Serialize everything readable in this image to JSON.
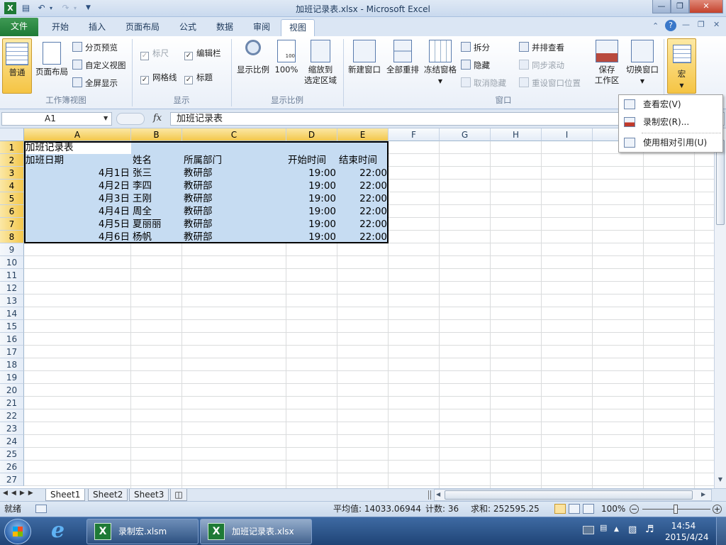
{
  "window": {
    "title": "加班记录表.xlsx - Microsoft Excel"
  },
  "ribbon_tabs": {
    "file": "文件",
    "home": "开始",
    "insert": "插入",
    "layout": "页面布局",
    "formula": "公式",
    "data": "数据",
    "review": "审阅",
    "view": "视图"
  },
  "ribbon": {
    "workbook_views": {
      "normal": "普通",
      "page_layout": "页面布局",
      "page_break": "分页预览",
      "custom_view": "自定义视图",
      "full_screen": "全屏显示",
      "group": "工作簿视图"
    },
    "show": {
      "ruler": "标尺",
      "formula_bar": "编辑栏",
      "gridlines": "网格线",
      "headings": "标题",
      "group": "显示"
    },
    "zoom": {
      "zoom": "显示比例",
      "hundred": "100%",
      "zoom_sel_1": "缩放到",
      "zoom_sel_2": "选定区域",
      "group": "显示比例"
    },
    "window": {
      "new_window": "新建窗口",
      "arrange_all": "全部重排",
      "freeze": "冻结窗格",
      "split": "拆分",
      "hide": "隐藏",
      "unhide": "取消隐藏",
      "side_by_side": "并排查看",
      "sync_scroll": "同步滚动",
      "reset_pos": "重设窗口位置",
      "save_ws_1": "保存",
      "save_ws_2": "工作区",
      "switch": "切换窗口",
      "group": "窗口"
    },
    "macros": {
      "label": "宏"
    }
  },
  "macro_menu": {
    "view": "查看宏(V)",
    "record": "录制宏(R)...",
    "relative": "使用相对引用(U)"
  },
  "formula_bar": {
    "name_box": "A1",
    "fx": "fx",
    "content": "加班记录表"
  },
  "columns": [
    "A",
    "B",
    "C",
    "D",
    "E",
    "F",
    "G",
    "H",
    "I"
  ],
  "rows": [
    "1",
    "2",
    "3",
    "4",
    "5",
    "6",
    "7",
    "8",
    "9",
    "10",
    "11",
    "12",
    "13",
    "14",
    "15",
    "16",
    "17",
    "18",
    "19",
    "20",
    "21",
    "22",
    "23",
    "24",
    "25",
    "26",
    "27"
  ],
  "sheet": {
    "title": "加班记录表",
    "headers": [
      "加班日期",
      "姓名",
      "所属部门",
      "开始时间",
      "结束时间"
    ],
    "data": [
      [
        "4月1日",
        "张三",
        "教研部",
        "19:00",
        "22:00"
      ],
      [
        "4月2日",
        "李四",
        "教研部",
        "19:00",
        "22:00"
      ],
      [
        "4月3日",
        "王刚",
        "教研部",
        "19:00",
        "22:00"
      ],
      [
        "4月4日",
        "周全",
        "教研部",
        "19:00",
        "22:00"
      ],
      [
        "4月5日",
        "夏丽丽",
        "教研部",
        "19:00",
        "22:00"
      ],
      [
        "4月6日",
        "杨帆",
        "教研部",
        "19:00",
        "22:00"
      ]
    ]
  },
  "sheet_tabs": [
    "Sheet1",
    "Sheet2",
    "Sheet3"
  ],
  "status": {
    "ready": "就绪",
    "average": "平均值: 14033.06944",
    "count": "计数: 36",
    "sum": "求和: 252595.25",
    "zoom": "100%"
  },
  "taskbar": {
    "app1": "录制宏.xlsm",
    "app2": "加班记录表.xlsx",
    "time": "14:54",
    "date": "2015/4/24"
  },
  "colors": {
    "accent": "#1e7a36",
    "selection": "#c6dcf2",
    "header_selected": "#f3c74c"
  }
}
